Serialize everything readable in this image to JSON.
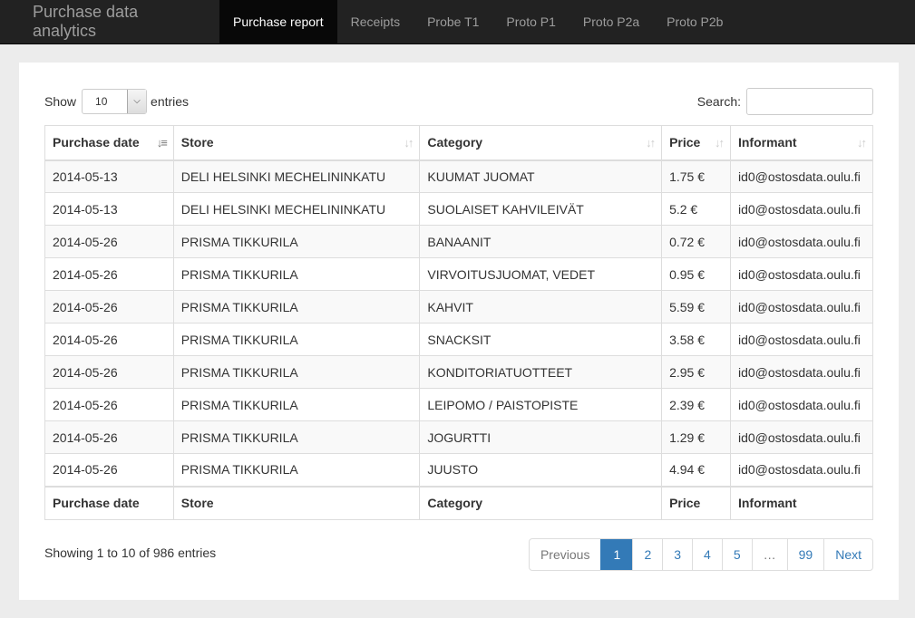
{
  "navbar": {
    "brand": "Purchase data analytics",
    "items": [
      {
        "label": "Purchase report",
        "active": true
      },
      {
        "label": "Receipts"
      },
      {
        "label": "Probe T1"
      },
      {
        "label": "Proto P1"
      },
      {
        "label": "Proto P2a"
      },
      {
        "label": "Proto P2b"
      }
    ]
  },
  "controls": {
    "show_label": "Show",
    "entries_label": "entries",
    "page_size": "10",
    "search_label": "Search:",
    "search_value": ""
  },
  "table": {
    "headers": [
      "Purchase date",
      "Store",
      "Category",
      "Price",
      "Informant"
    ],
    "sorted_column": 0,
    "rows": [
      [
        "2014-05-13",
        "DELI HELSINKI MECHELININKATU",
        "KUUMAT JUOMAT",
        "1.75 €",
        "id0@ostosdata.oulu.fi"
      ],
      [
        "2014-05-13",
        "DELI HELSINKI MECHELININKATU",
        "SUOLAISET KAHVILEIVÄT",
        "5.2 €",
        "id0@ostosdata.oulu.fi"
      ],
      [
        "2014-05-26",
        "PRISMA TIKKURILA",
        "BANAANIT",
        "0.72 €",
        "id0@ostosdata.oulu.fi"
      ],
      [
        "2014-05-26",
        "PRISMA TIKKURILA",
        "VIRVOITUSJUOMAT, VEDET",
        "0.95 €",
        "id0@ostosdata.oulu.fi"
      ],
      [
        "2014-05-26",
        "PRISMA TIKKURILA",
        "KAHVIT",
        "5.59 €",
        "id0@ostosdata.oulu.fi"
      ],
      [
        "2014-05-26",
        "PRISMA TIKKURILA",
        "SNACKSIT",
        "3.58 €",
        "id0@ostosdata.oulu.fi"
      ],
      [
        "2014-05-26",
        "PRISMA TIKKURILA",
        "KONDITORIATUOTTEET",
        "2.95 €",
        "id0@ostosdata.oulu.fi"
      ],
      [
        "2014-05-26",
        "PRISMA TIKKURILA",
        "LEIPOMO / PAISTOPISTE",
        "2.39 €",
        "id0@ostosdata.oulu.fi"
      ],
      [
        "2014-05-26",
        "PRISMA TIKKURILA",
        "JOGURTTI",
        "1.29 €",
        "id0@ostosdata.oulu.fi"
      ],
      [
        "2014-05-26",
        "PRISMA TIKKURILA",
        "JUUSTO",
        "4.94 €",
        "id0@ostosdata.oulu.fi"
      ]
    ]
  },
  "footer": {
    "info": "Showing 1 to 10 of 986 entries",
    "pagination": {
      "previous": "Previous",
      "pages": [
        "1",
        "2",
        "3",
        "4",
        "5",
        "…",
        "99"
      ],
      "current": "1",
      "next": "Next"
    }
  },
  "colors": {
    "navbar_bg": "#222222",
    "accent": "#337ab7",
    "page_bg": "#ececec"
  },
  "icons": {
    "sort_active": "sort-ascending-icon",
    "sort_inactive": "sort-both-icon",
    "select_caret": "chevron-down-icon"
  }
}
